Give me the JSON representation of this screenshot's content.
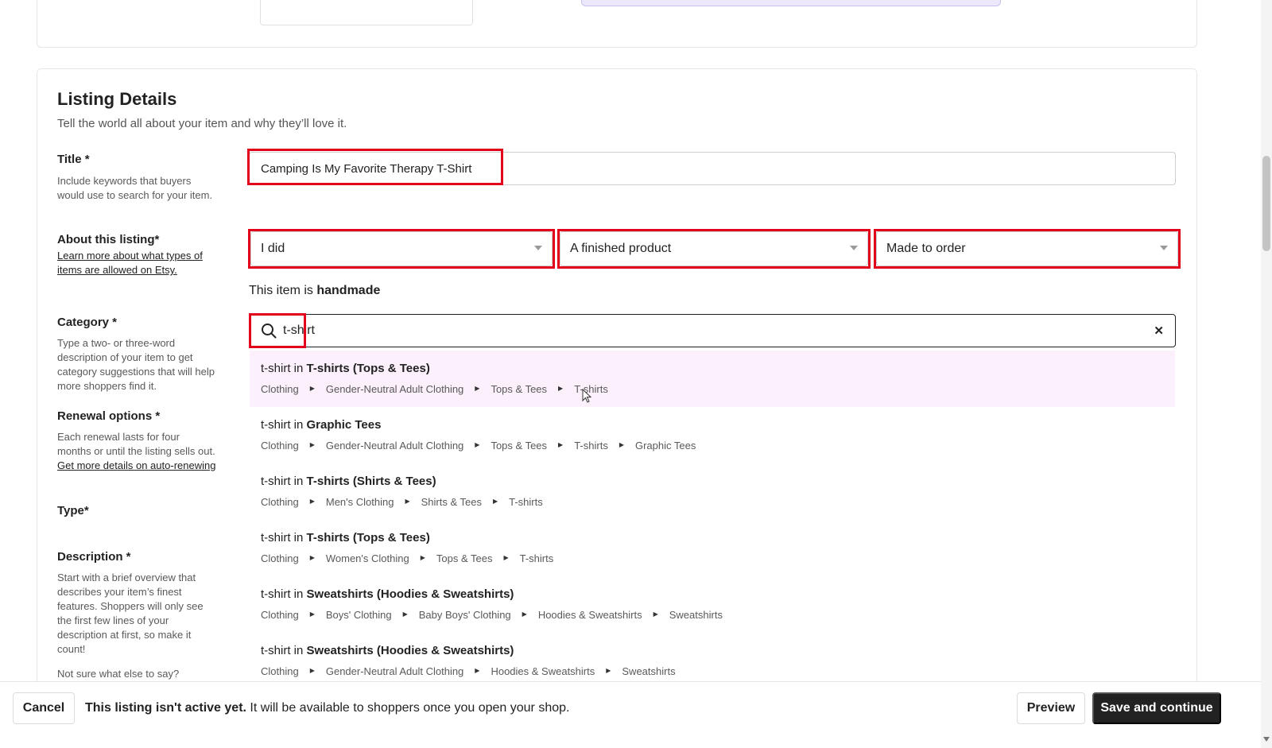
{
  "section": {
    "title": "Listing Details",
    "subtitle": "Tell the world all about your item and why they’ll love it."
  },
  "title_field": {
    "label": "Title *",
    "help": "Include keywords that buyers would use to search for your item.",
    "value": "Camping Is My Favorite Therapy T-Shirt"
  },
  "about_field": {
    "label": "About this listing*",
    "help_link": "Learn more about what types of items are allowed on Etsy.",
    "who_made": "I did",
    "what_is_it": "A finished product",
    "when_made": "Made to order",
    "note_prefix": "This item is",
    "note_bold": "handmade"
  },
  "category_field": {
    "label": "Category *",
    "help": "Type a two- or three-word description of your item to get category suggestions that will help more shoppers find it.",
    "search_value": "t-shirt",
    "clear_icon": "close-icon"
  },
  "renewal_field": {
    "label": "Renewal options *",
    "help_text": "Each renewal lasts for four months or until the listing sells out.",
    "help_link": "Get more details on auto-renewing"
  },
  "type_field": {
    "label": "Type*"
  },
  "description_field": {
    "label": "Description *",
    "help": "Start with a brief overview that describes your item’s finest features. Shoppers will only see the first few lines of your description at first, so make it count!",
    "help2": "Not sure what else to say?"
  },
  "suggestions": [
    {
      "prefix": "t-shirt in",
      "name": "T-shirts (Tops & Tees)",
      "path": [
        "Clothing",
        "Gender-Neutral Adult Clothing",
        "Tops & Tees",
        "T-shirts"
      ]
    },
    {
      "prefix": "t-shirt in",
      "name": "Graphic Tees",
      "path": [
        "Clothing",
        "Gender-Neutral Adult Clothing",
        "Tops & Tees",
        "T-shirts",
        "Graphic Tees"
      ]
    },
    {
      "prefix": "t-shirt in",
      "name": "T-shirts (Shirts & Tees)",
      "path": [
        "Clothing",
        "Men's Clothing",
        "Shirts & Tees",
        "T-shirts"
      ]
    },
    {
      "prefix": "t-shirt in",
      "name": "T-shirts (Tops & Tees)",
      "path": [
        "Clothing",
        "Women's Clothing",
        "Tops & Tees",
        "T-shirts"
      ]
    },
    {
      "prefix": "t-shirt in",
      "name": "Sweatshirts (Hoodies & Sweatshirts)",
      "path": [
        "Clothing",
        "Boys' Clothing",
        "Baby Boys' Clothing",
        "Hoodies & Sweatshirts",
        "Sweatshirts"
      ]
    },
    {
      "prefix": "t-shirt in",
      "name": "Sweatshirts (Hoodies & Sweatshirts)",
      "path": [
        "Clothing",
        "Gender-Neutral Adult Clothing",
        "Hoodies & Sweatshirts",
        "Sweatshirts"
      ]
    }
  ],
  "footer": {
    "cancel": "Cancel",
    "message_bold": "This listing isn't active yet.",
    "message_rest": "It will be available to shoppers once you open your shop.",
    "preview": "Preview",
    "save": "Save and continue"
  },
  "colors": {
    "highlight": "#e3001b",
    "active_suggestion": "#fbf0fb",
    "primary_button": "#222222"
  }
}
